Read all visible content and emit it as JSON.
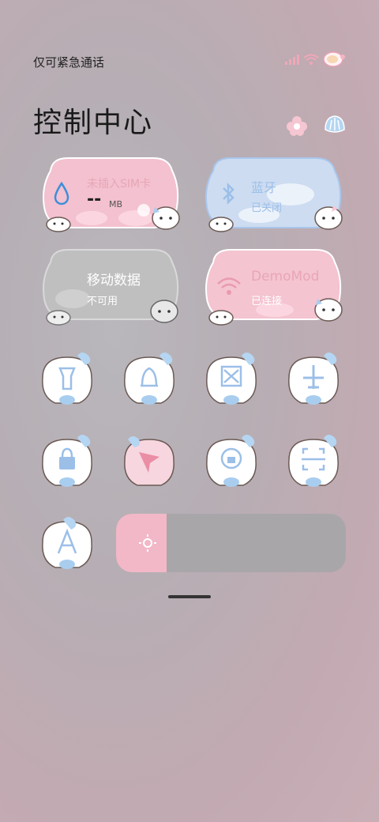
{
  "status_bar": {
    "carrier": "仅可紧急通话",
    "icons": [
      "signal-icon",
      "wifi-icon",
      "battery-icon"
    ]
  },
  "header": {
    "title": "控制中心",
    "icons": [
      "flower-pink-icon",
      "shell-blue-icon"
    ]
  },
  "cards": [
    {
      "id": "data-usage",
      "label": "未插入SIM卡",
      "value": "--",
      "unit": "MB",
      "icon": "drop-icon",
      "color": "#f3c1cf"
    },
    {
      "id": "bluetooth",
      "label": "蓝牙",
      "sub": "已关闭",
      "icon": "bluetooth-icon",
      "color": "#cddcf1"
    },
    {
      "id": "mobile-data",
      "label": "移动数据",
      "sub": "不可用",
      "icon": "",
      "color": "#bfbfc0"
    },
    {
      "id": "wifi",
      "label": "DemoMod",
      "sub": "已连接",
      "icon": "wifi-icon",
      "color": "#f4c4d0"
    }
  ],
  "tiles": [
    {
      "name": "flashlight",
      "icon": "flashlight-icon"
    },
    {
      "name": "ring",
      "icon": "bell-icon"
    },
    {
      "name": "screenshot",
      "icon": "scissors-icon"
    },
    {
      "name": "airplane-mode",
      "icon": "airplane-icon"
    },
    {
      "name": "lock-screen",
      "icon": "lock-icon"
    },
    {
      "name": "location",
      "icon": "location-arrow-icon"
    },
    {
      "name": "rotation-lock",
      "icon": "rotate-lock-icon"
    },
    {
      "name": "scanner",
      "icon": "scan-icon"
    },
    {
      "name": "font-size",
      "icon": "letter-a-icon"
    }
  ],
  "brightness": {
    "level": 0.22,
    "icon": "sun-icon"
  },
  "colors": {
    "pink": "#f2b8c8",
    "blue": "#a9cdee",
    "text_pink": "#e8a6b7",
    "text_blue": "#9cbfe8"
  }
}
